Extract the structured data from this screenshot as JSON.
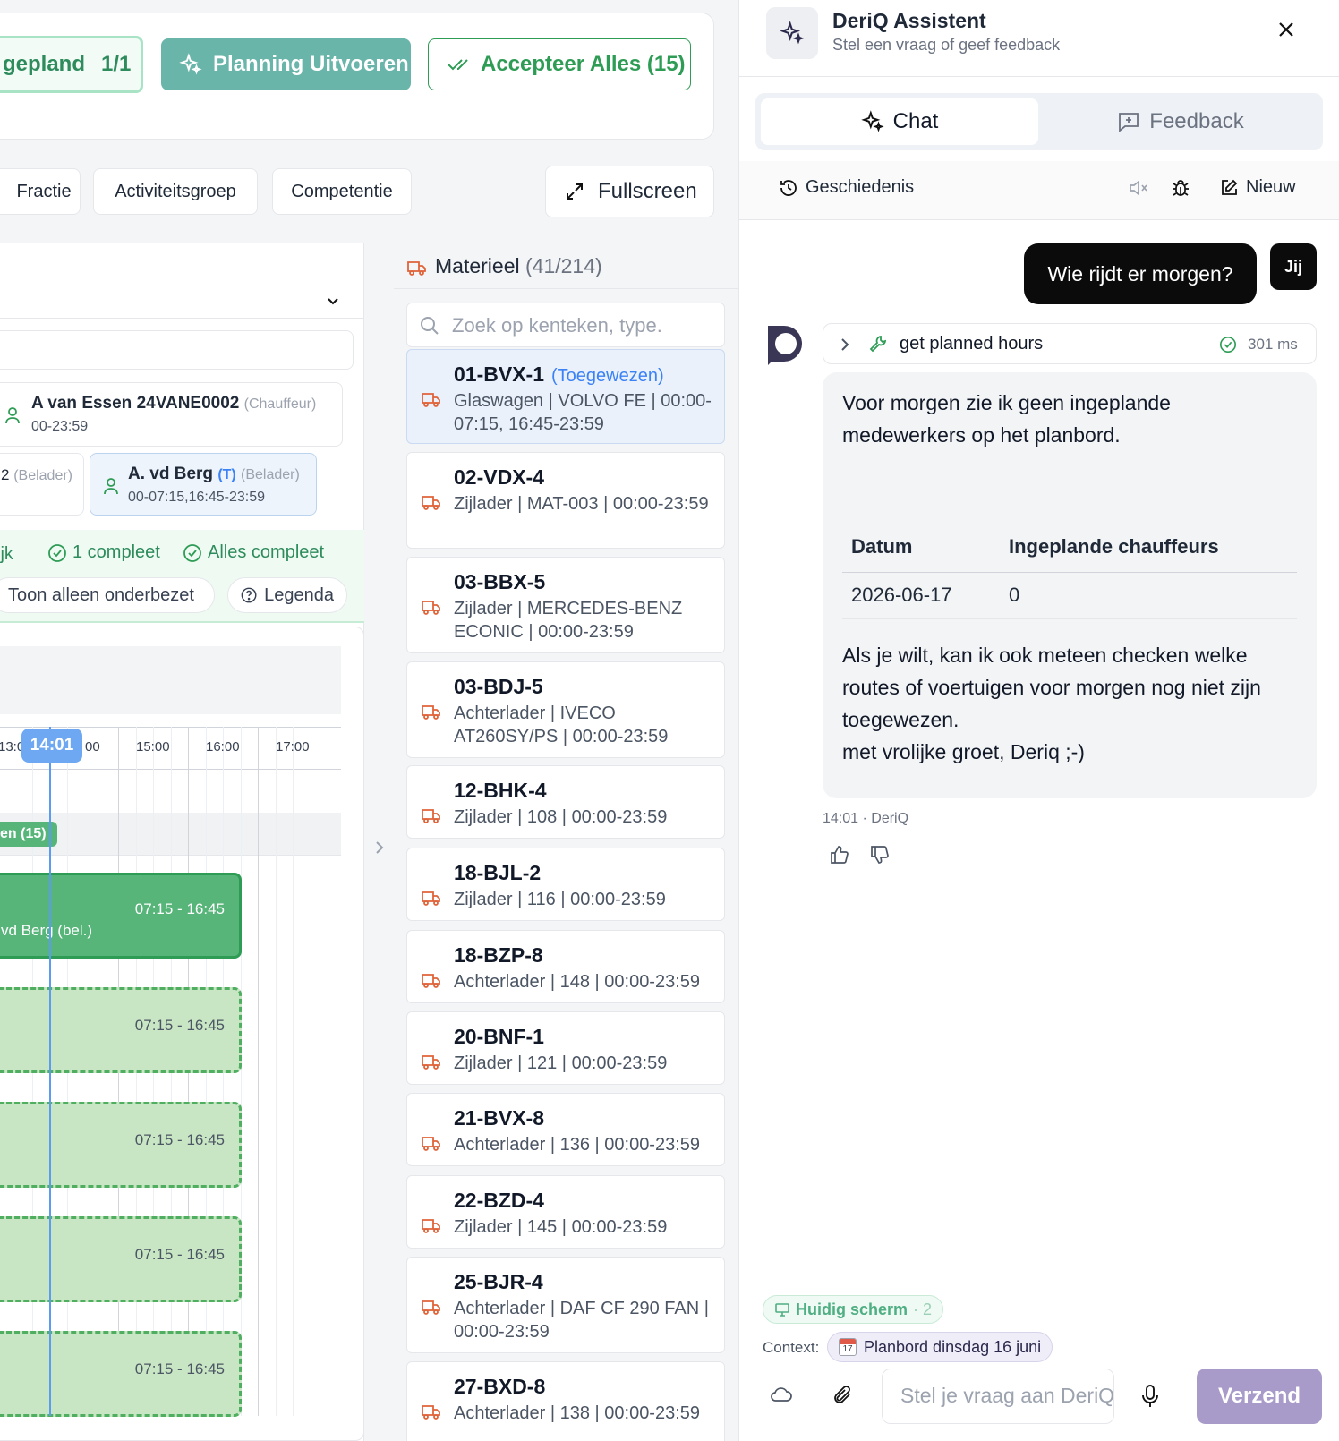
{
  "toolbar": {
    "gepland_label": "gepland",
    "gepland_count": "1/1",
    "plan_label": "Planning Uitvoeren",
    "accept_label": "Accepteer Alles (15)"
  },
  "filters": [
    "Fractie",
    "Activiteitsgroep",
    "Competentie"
  ],
  "fullscreen_label": "Fullscreen",
  "personnel": {
    "p1_name": "A van Essen 24VANE0002",
    "p1_role": "(Chauffeur)",
    "p1_time": "00-23:59",
    "p2_partial": "2",
    "p2_role": "(Belader)",
    "p3_name": "A. vd Berg",
    "p3_tag": "(T)",
    "p3_role": "(Belader)",
    "p3_time": "00-07:15,16:45-23:59"
  },
  "completion": {
    "partial": "ijk",
    "one": "1 compleet",
    "all": "Alles compleet",
    "onderbezet": "Toon alleen onderbezet",
    "legenda": "Legenda"
  },
  "timeline": {
    "now": "14:01",
    "hours": [
      "13:0",
      "00",
      "15:00",
      "16:00",
      "17:00"
    ],
    "row_label": "en (15)",
    "block_time": "07:15 - 16:45",
    "block_label": "vd Berg (bel.)"
  },
  "materieel": {
    "title": "Materieel",
    "count": "(41/214)",
    "search_placeholder": "Zoek op kenteken, type.",
    "items": [
      {
        "plate": "01-BVX-1",
        "tag": "(Toegewezen)",
        "desc": "Glaswagen | VOLVO FE | 00:00-07:15, 16:45-23:59"
      },
      {
        "plate": "02-VDX-4",
        "tag": "",
        "desc": "Zijlader | MAT-003 | 00:00-23:59"
      },
      {
        "plate": "03-BBX-5",
        "tag": "",
        "desc": "Zijlader | MERCEDES-BENZ ECONIC | 00:00-23:59"
      },
      {
        "plate": "03-BDJ-5",
        "tag": "",
        "desc": "Achterlader | IVECO AT260SY/PS | 00:00-23:59"
      },
      {
        "plate": "12-BHK-4",
        "tag": "",
        "desc": "Zijlader | 108 | 00:00-23:59"
      },
      {
        "plate": "18-BJL-2",
        "tag": "",
        "desc": "Zijlader | 116 | 00:00-23:59"
      },
      {
        "plate": "18-BZP-8",
        "tag": "",
        "desc": "Achterlader | 148 | 00:00-23:59"
      },
      {
        "plate": "20-BNF-1",
        "tag": "",
        "desc": "Zijlader | 121 | 00:00-23:59"
      },
      {
        "plate": "21-BVX-8",
        "tag": "",
        "desc": "Achterlader | 136 | 00:00-23:59"
      },
      {
        "plate": "22-BZD-4",
        "tag": "",
        "desc": "Zijlader | 145 | 00:00-23:59"
      },
      {
        "plate": "25-BJR-4",
        "tag": "",
        "desc": "Achterlader | DAF CF 290 FAN | 00:00-23:59"
      },
      {
        "plate": "27-BXD-8",
        "tag": "",
        "desc": "Achterlader | 138 | 00:00-23:59"
      }
    ]
  },
  "assistant": {
    "title": "DeriQ Assistent",
    "subtitle": "Stel een vraag of geef feedback",
    "tab_chat": "Chat",
    "tab_feedback": "Feedback",
    "history": "Geschiedenis",
    "new": "Nieuw",
    "user_message": "Wie rijdt er morgen?",
    "user_badge": "Jij",
    "tool_name": "get planned hours",
    "tool_time": "301 ms",
    "answer_intro": "Voor morgen zie ik geen ingeplande medewerkers op het planbord.",
    "table_headers": [
      "Datum",
      "Ingeplande chauffeurs"
    ],
    "table_row": [
      "2026-06-17",
      "0"
    ],
    "answer_outro": "Als je wilt, kan ik ook meteen checken welke routes of voertuigen voor morgen nog niet zijn toegewezen.",
    "signoff": "met vrolijke groet, Deriq ;-)",
    "meta": "14:01 · DeriQ",
    "screen_chip": "Huidig scherm",
    "screen_count": "· 2",
    "context_label": "Context:",
    "context_value": "Planbord dinsdag 16 juni",
    "calendar_day": "17",
    "input_placeholder": "Stel je vraag aan DeriQ",
    "send": "Verzend"
  },
  "colors": {
    "accent_green": "#2e9c55",
    "teal": "#6ab5aa",
    "now_blue": "#5b9bf0",
    "truck_orange": "#e0633a",
    "send_purple": "#a89bc9"
  }
}
